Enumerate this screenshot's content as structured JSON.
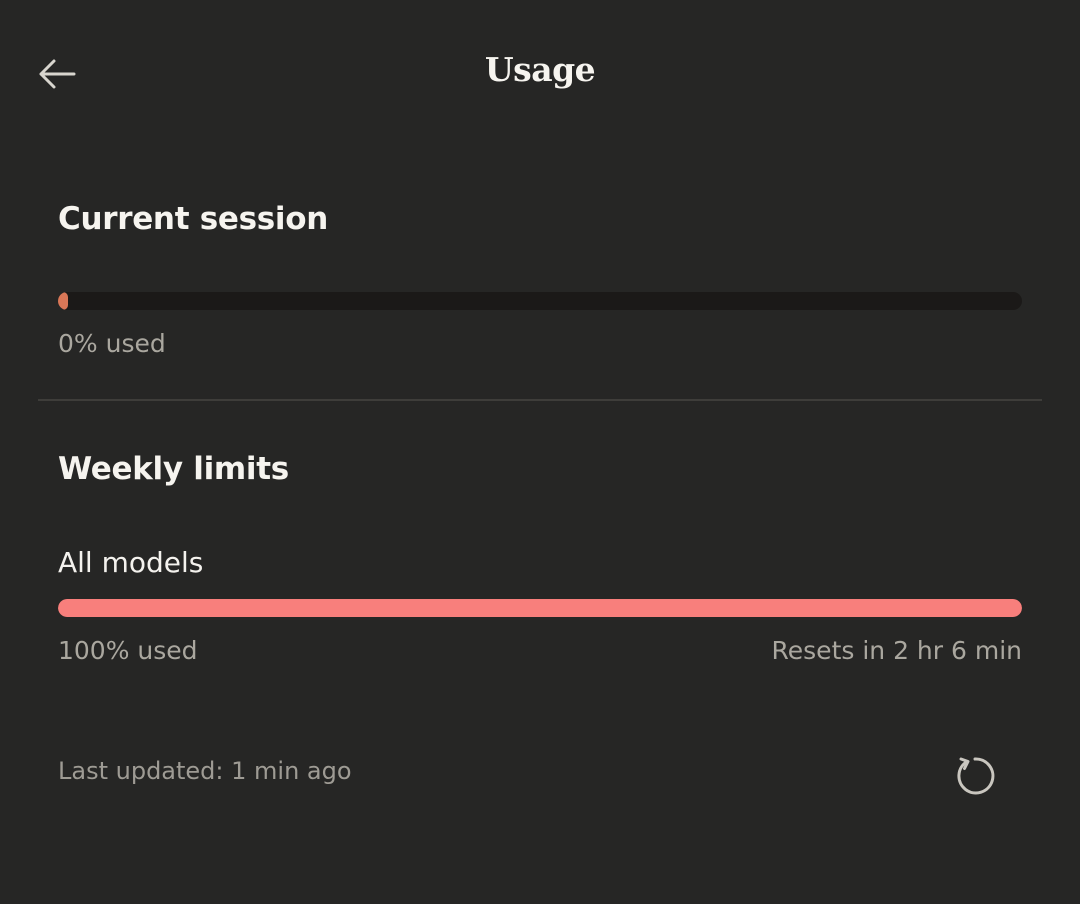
{
  "header": {
    "title": "Usage",
    "back_icon": "arrow-left-icon"
  },
  "current_session": {
    "title": "Current session",
    "percent_used": 0,
    "used_label": "0% used",
    "bar_color": "#d97757"
  },
  "weekly_limits": {
    "title": "Weekly limits",
    "all_models": {
      "label": "All models",
      "percent_used": 100,
      "used_label": "100% used",
      "reset_label": "Resets in 2 hr 6 min",
      "bar_color": "#f87f7c"
    }
  },
  "footer": {
    "last_updated": "Last updated: 1 min ago",
    "refresh_icon": "refresh-icon"
  },
  "colors": {
    "background": "#262625",
    "track": "#1b1918",
    "divider": "#3e3d3a"
  }
}
